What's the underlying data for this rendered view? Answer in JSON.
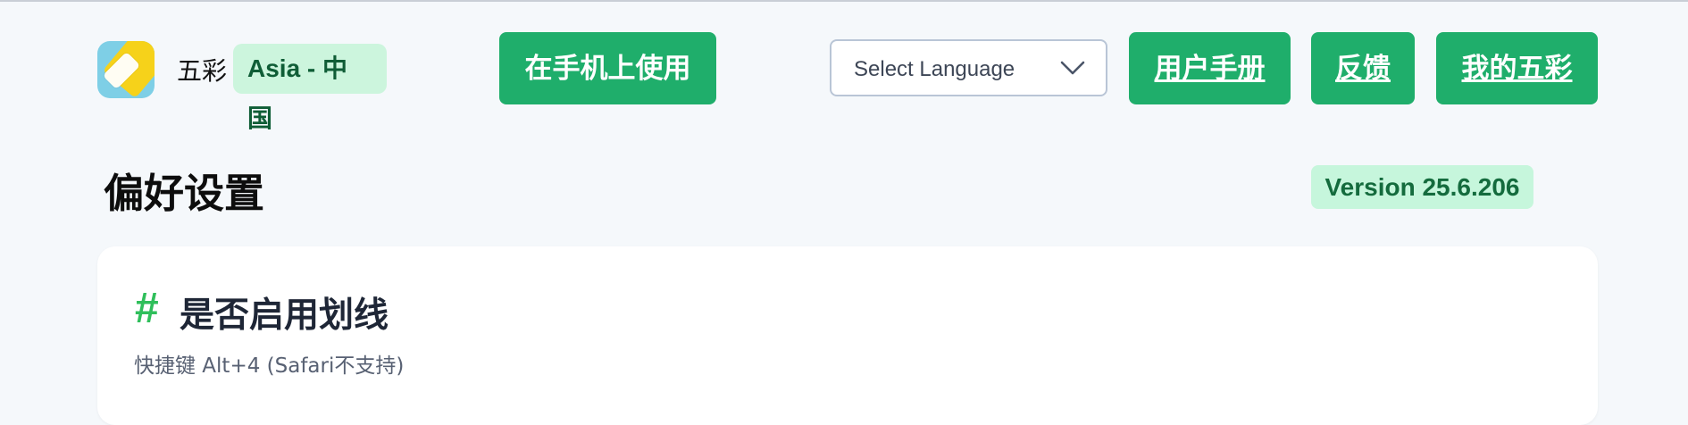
{
  "header": {
    "brand": "五彩",
    "region_badge": "Asia - 中国",
    "mobile_button": "在手机上使用",
    "language_select": {
      "selected": "Select Language"
    },
    "manual_link": "用户手册",
    "feedback_link": "反馈",
    "my_account_link": "我的五彩"
  },
  "page": {
    "title": "偏好设置",
    "version": "Version 25.6.206"
  },
  "card": {
    "hash": "#",
    "title": "是否启用划线",
    "subtitle": "快捷键 Alt+4 (Safari不支持)"
  },
  "colors": {
    "accent": "#1fae6b",
    "badge_bg": "#ccf5dd",
    "badge_text": "#0f5d36",
    "page_bg": "#f5f8fb"
  },
  "icons": [
    "app-logo-icon",
    "chevron-down-icon"
  ]
}
